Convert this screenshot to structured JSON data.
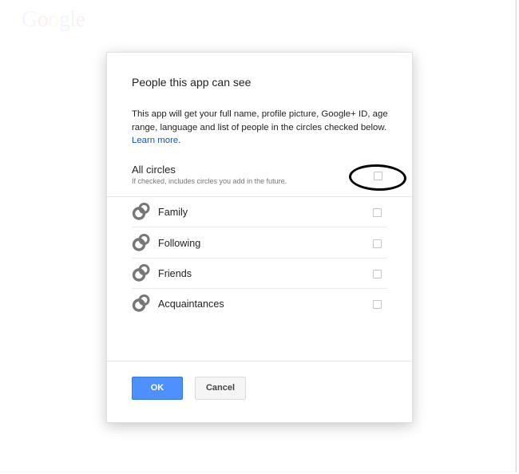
{
  "brand": {
    "logo_letters": [
      "G",
      "o",
      "o",
      "g",
      "l",
      "e"
    ],
    "logo_colors": [
      "#3369e8",
      "#d50f25",
      "#eeb211",
      "#3369e8",
      "#009925",
      "#d50f25"
    ]
  },
  "dialog": {
    "title": "People this app can see",
    "description": "This app will get your full name, profile picture, Google+ ID, age range, language and list of people in the circles checked below.",
    "learn_more": "Learn more",
    "description_end": ".",
    "all_circles": {
      "label": "All circles",
      "sublabel": "If checked, includes circles you add in the future.",
      "checked": false
    },
    "circles": [
      {
        "label": "Family",
        "checked": false,
        "icon": "circles-icon"
      },
      {
        "label": "Following",
        "checked": false,
        "icon": "circles-icon"
      },
      {
        "label": "Friends",
        "checked": false,
        "icon": "circles-icon"
      },
      {
        "label": "Acquaintances",
        "checked": false,
        "icon": "circles-icon"
      }
    ],
    "ok_label": "OK",
    "cancel_label": "Cancel"
  },
  "annotation": {
    "shape": "hand-drawn ellipse",
    "target": "all-circles-checkbox",
    "color": "#000000"
  },
  "colors": {
    "link": "#1155cc",
    "primary_button": "#4d90fe",
    "text": "#222222"
  }
}
